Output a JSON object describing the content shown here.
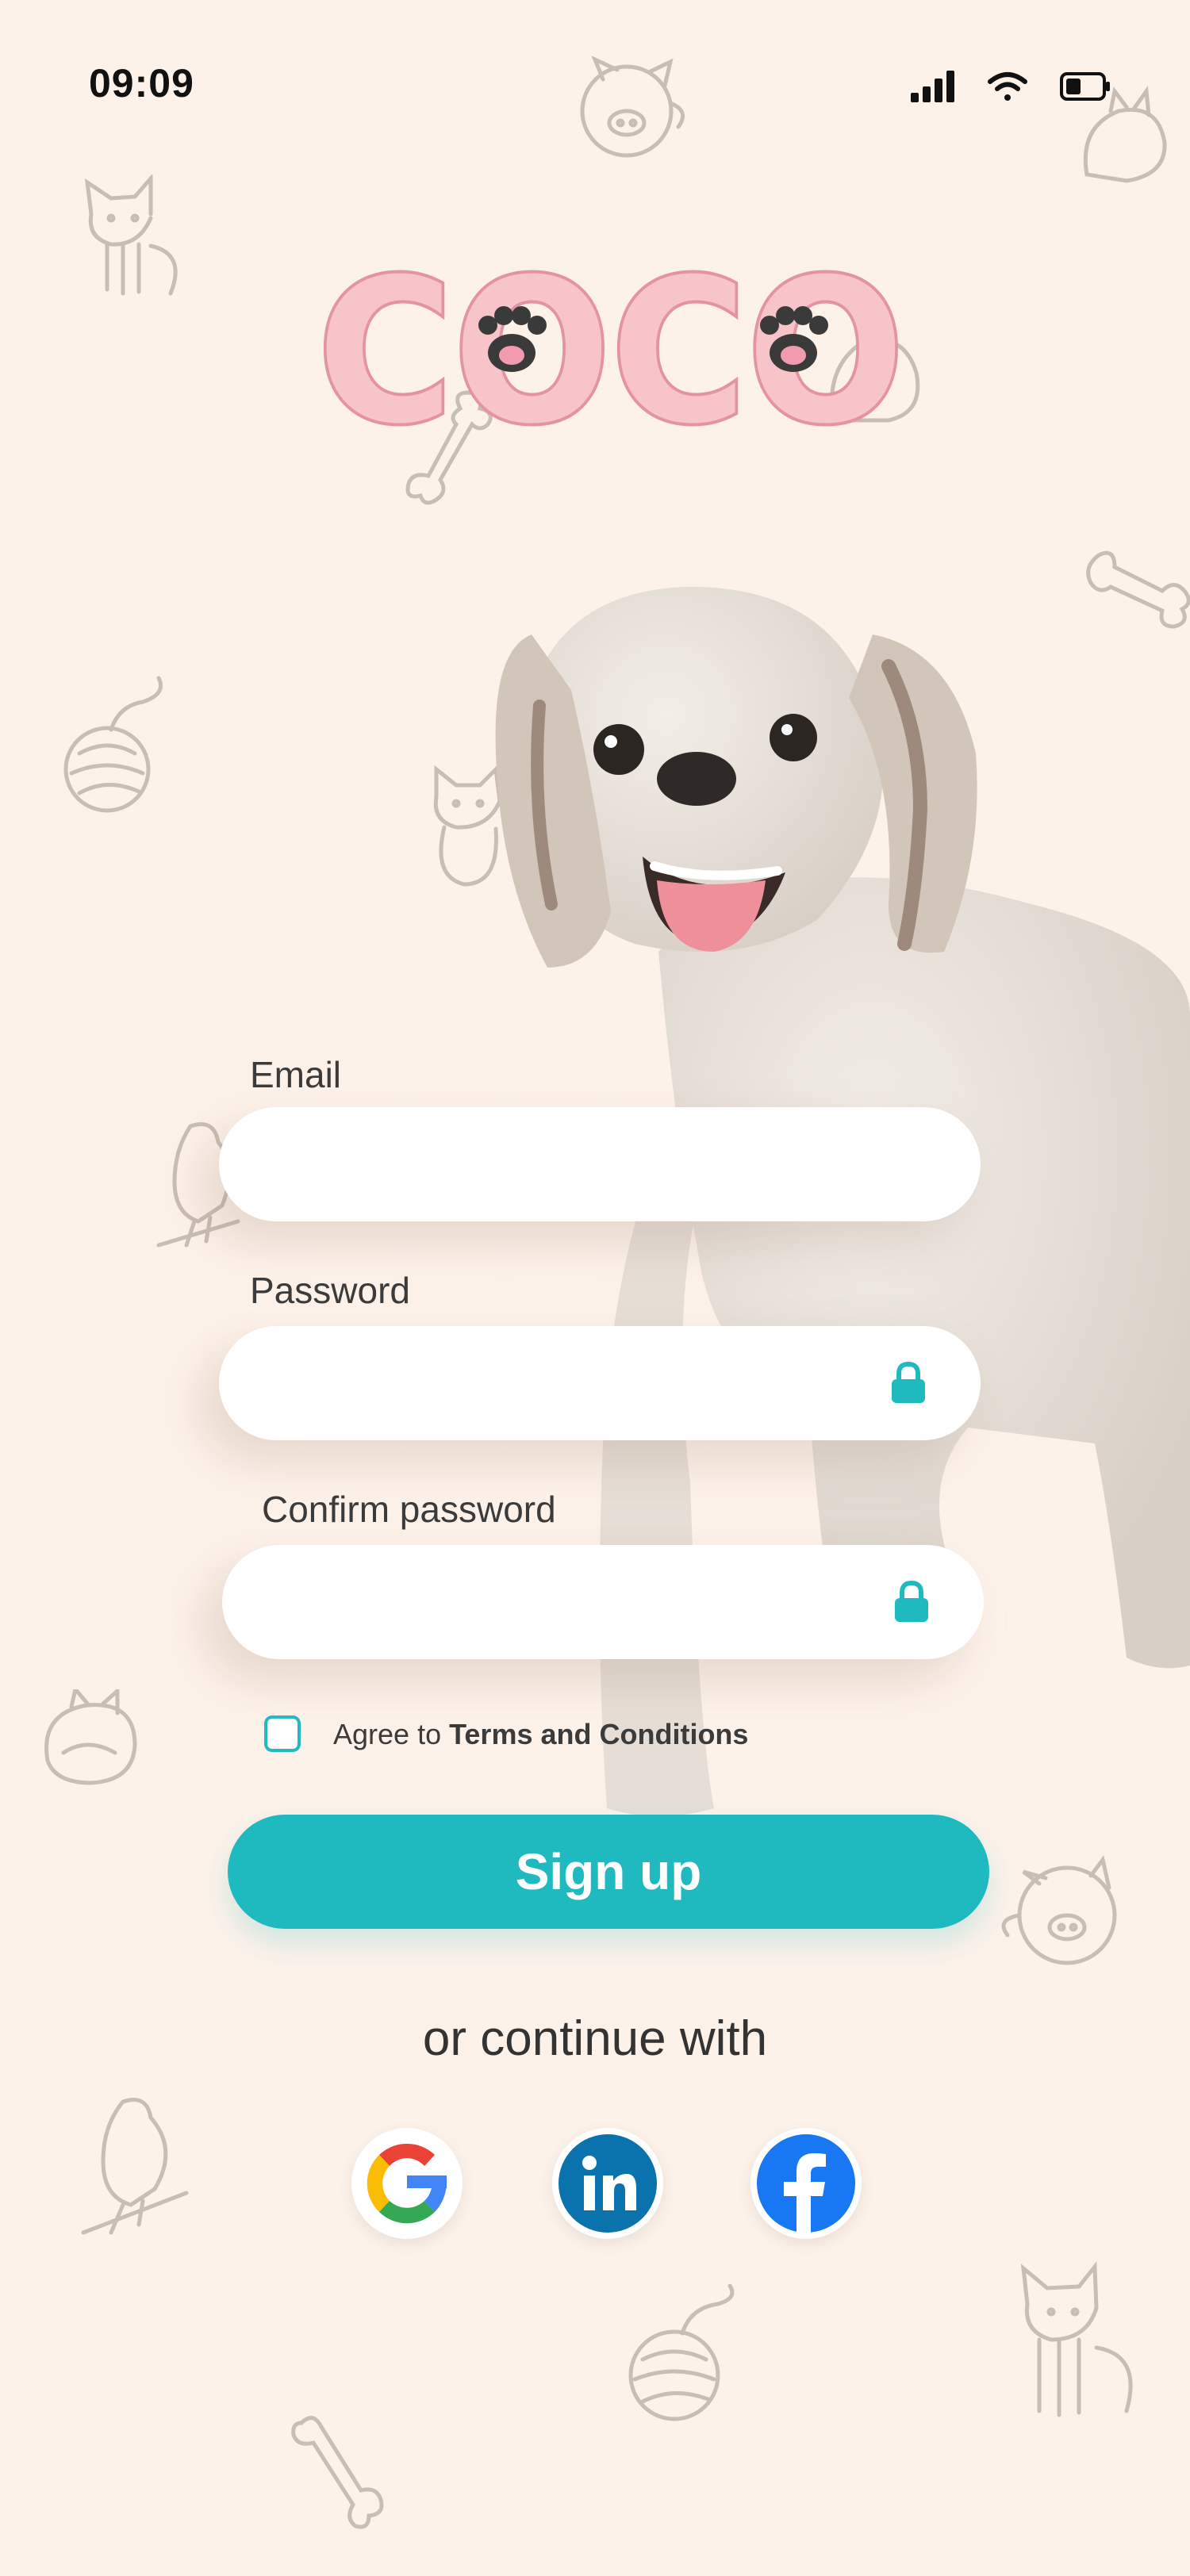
{
  "status_bar": {
    "time": "09:09"
  },
  "logo": {
    "text": "COCO"
  },
  "form": {
    "email_label": "Email",
    "password_label": "Password",
    "confirm_label": "Confirm password",
    "agree_prefix": "Agree to ",
    "terms_link": "Terms and Conditions",
    "signup_label": "Sign up"
  },
  "social": {
    "heading": "or continue with",
    "providers": [
      "google-icon",
      "linkedin-icon",
      "facebook-icon"
    ]
  },
  "colors": {
    "background": "#fdf2ea",
    "accent": "#1fbabf",
    "logo_pink": "#f7c4c9",
    "text": "#333333"
  }
}
